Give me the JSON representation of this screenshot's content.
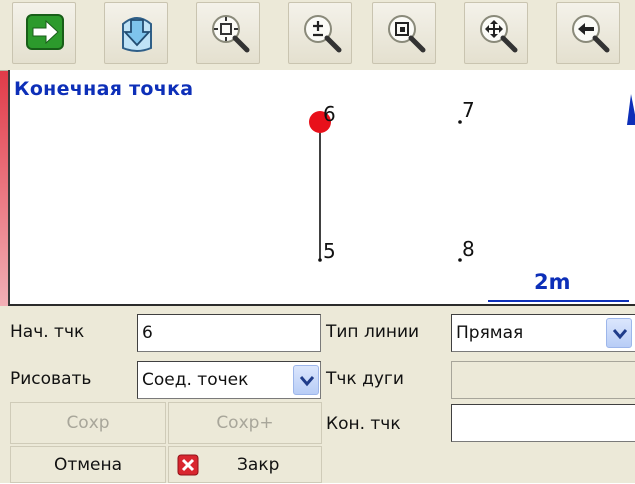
{
  "toolbar": {
    "buttons": [
      {
        "icon": "arrow-right-icon"
      },
      {
        "icon": "compass-icon"
      },
      {
        "icon": "zoom-fit-icon"
      },
      {
        "icon": "zoom-in-out-icon"
      },
      {
        "icon": "zoom-window-icon"
      },
      {
        "icon": "pan-icon"
      },
      {
        "icon": "back-arrow-icon"
      }
    ]
  },
  "map": {
    "title": "Конечная точка",
    "points": [
      {
        "label": "6",
        "selected": true
      },
      {
        "label": "7",
        "selected": false
      },
      {
        "label": "5",
        "selected": false
      },
      {
        "label": "8",
        "selected": false
      }
    ],
    "scale_label": "2m",
    "colors": {
      "title": "#0d2fb8",
      "selected_point": "#e8101a",
      "scale": "#0d2fb8"
    }
  },
  "form": {
    "start_point_label": "Нач. тчк",
    "start_point_value": "6",
    "draw_label": "Рисовать",
    "draw_value": "Соед. точек",
    "line_type_label": "Тип линии",
    "line_type_value": "Прямая",
    "arc_point_label": "Тчк дуги",
    "arc_point_value": "",
    "end_point_label": "Кон. тчк",
    "end_point_value": ""
  },
  "buttons": {
    "save": "Сохр",
    "save_plus": "Сохр+",
    "cancel": "Отмена",
    "close": "Закр"
  }
}
